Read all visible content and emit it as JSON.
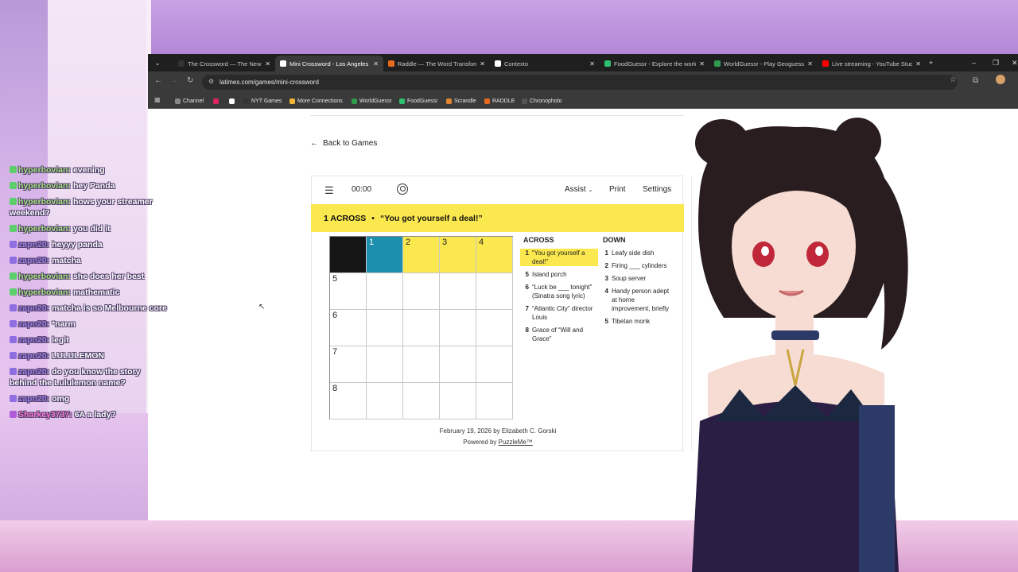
{
  "browser": {
    "tabs": [
      {
        "title": "The Crossword — The New Yo...",
        "favicon_color": "#333333",
        "active": false
      },
      {
        "title": "Mini Crossword - Los Angeles T",
        "favicon_color": "#ffffff",
        "active": true
      },
      {
        "title": "Raddle — The Word Transform...",
        "favicon_color": "#e66a1f",
        "active": false
      },
      {
        "title": "Contexto",
        "favicon_color": "#ffffff",
        "active": false
      },
      {
        "title": "FoodGuessr - Explore the world",
        "favicon_color": "#2fbf71",
        "active": false
      },
      {
        "title": "WorldGuessr - Play Geoguessr",
        "favicon_color": "#2f9b4e",
        "active": false
      },
      {
        "title": "Live streaming - YouTube Studio",
        "favicon_color": "#ff0000",
        "active": false
      }
    ],
    "url": "latimes.com/games/mini-crossword",
    "bookmarks": [
      {
        "label": "Channel",
        "color": "#8a8a8a"
      },
      {
        "label": "",
        "color": "#e0245e"
      },
      {
        "label": "",
        "color": "#ffffff"
      },
      {
        "label": "NYT Games",
        "color": "#333333"
      },
      {
        "label": "More Connections",
        "color": "#f2b636"
      },
      {
        "label": "WorldGuessr",
        "color": "#2f9b4e"
      },
      {
        "label": "FoodGuessr",
        "color": "#2fbf71"
      },
      {
        "label": "Scrandle",
        "color": "#e5862f"
      },
      {
        "label": "RADDLE",
        "color": "#e66a1f"
      },
      {
        "label": "Chronophoto",
        "color": "#555555"
      }
    ]
  },
  "game": {
    "back_label": "Back to Games",
    "timer": "00:00",
    "assist_label": "Assist",
    "print_label": "Print",
    "settings_label": "Settings",
    "current_clue_number": "1 ACROSS",
    "current_clue_sep": "•",
    "current_clue_text": "“You got yourself a deal!”",
    "grid": [
      [
        "black",
        "1",
        "2",
        "3",
        "4"
      ],
      [
        "5",
        "",
        "",
        "",
        ""
      ],
      [
        "6",
        "",
        "",
        "",
        ""
      ],
      [
        "7",
        "",
        "",
        "",
        ""
      ],
      [
        "8",
        "",
        "",
        "",
        ""
      ]
    ],
    "across_title": "ACROSS",
    "down_title": "DOWN",
    "across": [
      {
        "n": "1",
        "text": "“You got yourself a deal!”"
      },
      {
        "n": "5",
        "text": "Island porch"
      },
      {
        "n": "6",
        "text": "“Luck be ___ tonight” (Sinatra song lyric)"
      },
      {
        "n": "7",
        "text": "“Atlantic City” director Louis"
      },
      {
        "n": "8",
        "text": "Grace of “Will and Grace”"
      }
    ],
    "down": [
      {
        "n": "1",
        "text": "Leafy side dish"
      },
      {
        "n": "2",
        "text": "Firing ___ cylinders"
      },
      {
        "n": "3",
        "text": "Soup server"
      },
      {
        "n": "4",
        "text": "Handy person adept at home improvement, briefly"
      },
      {
        "n": "5",
        "text": "Tibetan monk"
      }
    ],
    "credit_line": "February 19, 2026 by Elizabeth C. Gorski",
    "powered_prefix": "Powered by",
    "powered_link": "PuzzleMe™"
  },
  "chat": [
    {
      "user": "hyperbovian:",
      "text": "evening",
      "kind": "hyp"
    },
    {
      "user": "hyperbovian:",
      "text": "hey Panda",
      "kind": "hyp"
    },
    {
      "user": "hyperbovian:",
      "text": "hows your streamer weekend?",
      "kind": "hyp"
    },
    {
      "user": "hyperbovian:",
      "text": "you did it",
      "kind": "hyp"
    },
    {
      "user": "zapn20:",
      "text": "heyyy panda",
      "kind": "zap"
    },
    {
      "user": "zapn20:",
      "text": "matcha",
      "kind": "zap"
    },
    {
      "user": "hyperbovian:",
      "text": "she does her best",
      "kind": "hyp"
    },
    {
      "user": "hyperbovian:",
      "text": "mathematic",
      "kind": "hyp"
    },
    {
      "user": "zapn20:",
      "text": "matcha is so Melbourne core",
      "kind": "zap"
    },
    {
      "user": "zapn20:",
      "text": "*narm",
      "kind": "zap"
    },
    {
      "user": "zapn20:",
      "text": "legit",
      "kind": "zap"
    },
    {
      "user": "zapn20:",
      "text": "LULULEMON",
      "kind": "zap"
    },
    {
      "user": "zapn20:",
      "text": "do you know the story behind the Lululemon name?",
      "kind": "zap"
    },
    {
      "user": "zapn20:",
      "text": "omg",
      "kind": "zap"
    },
    {
      "user": "Sharkey3737:",
      "text": "6A a lady?",
      "kind": "shark"
    }
  ]
}
